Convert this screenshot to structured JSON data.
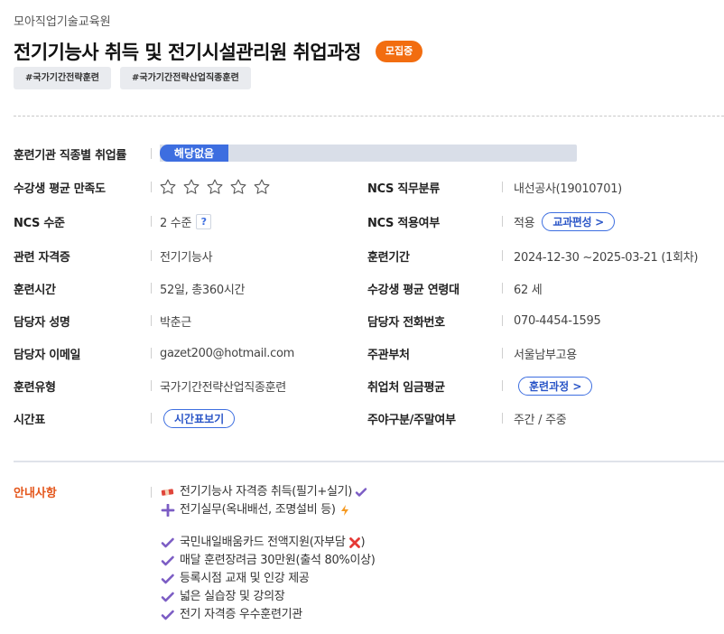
{
  "header": {
    "institution": "모아직업기술교육원",
    "course_title": "전기기능사 취득 및 전기시설관리원 취업과정",
    "status_badge": "모집중",
    "tags": [
      "#국가기간전략훈련",
      "#국가기간전략산업직종훈련"
    ]
  },
  "employment_rate": {
    "label": "훈련기관 직종별 취업률",
    "value_text": "해당없음"
  },
  "details": {
    "satisfaction": {
      "label": "수강생 평균 만족도",
      "stars_filled": 0,
      "stars_total": 5
    },
    "ncs_class": {
      "label": "NCS 직무분류",
      "value": "내선공사(19010701)"
    },
    "ncs_level": {
      "label": "NCS 수준",
      "value": "2 수준",
      "help": "?"
    },
    "ncs_applied": {
      "label": "NCS 적용여부",
      "value": "적용",
      "button": "교과편성 >"
    },
    "certificate": {
      "label": "관련 자격증",
      "value": "전기기능사"
    },
    "period": {
      "label": "훈련기간",
      "value": "2024-12-30 ~2025-03-21 (1회차)"
    },
    "hours": {
      "label": "훈련시간",
      "value": "52일, 총360시간"
    },
    "age": {
      "label": "수강생 평균 연령대",
      "value": "62 세"
    },
    "manager_name": {
      "label": "담당자 성명",
      "value": "박춘근"
    },
    "manager_phone": {
      "label": "담당자 전화번호",
      "value": "070-4454-1595"
    },
    "manager_email": {
      "label": "담당자 이메일",
      "value": "gazet200@hotmail.com"
    },
    "department": {
      "label": "주관부처",
      "value": "서울남부고용"
    },
    "training_type": {
      "label": "훈련유형",
      "value": "국가기간전략산업직종훈련"
    },
    "wage": {
      "label": "취업처 임금평균",
      "button": "훈련과정 >"
    },
    "timetable": {
      "label": "시간표",
      "button": "시간표보기"
    },
    "day_type": {
      "label": "주야구분/주말여부",
      "value": "주간 / 주중"
    }
  },
  "notice": {
    "label": "안내사항",
    "lines": [
      "전기기능사 자격증 취득(필기+실기)",
      "전기실무(옥내배선, 조명설비 등)",
      "국민내일배움카드 전액지원(자부담",
      "매달 훈련장려금 30만원(출석 80%이상)",
      "등록시점 교재 및 인강 제공",
      "넓은 실습장 및 강의장",
      "전기 자격증 우수훈련기관"
    ],
    "line3_suffix": ")",
    "icons": [
      "crayon-icon",
      "plus-icon",
      "check-icon",
      "lightning-icon",
      "cross-icon"
    ]
  },
  "colors": {
    "accent_blue": "#3d6ee0",
    "badge_orange": "#f26d10",
    "notice_orange": "#e4561b",
    "check_purple": "#7b5cc4"
  }
}
